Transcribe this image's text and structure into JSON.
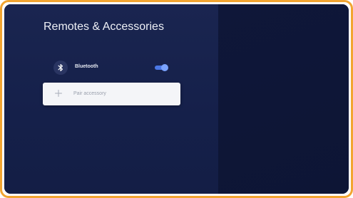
{
  "colors": {
    "frame_border": "#f2a531",
    "background": "#142046",
    "toggle_on": "#4b78e6",
    "card": "#f4f5f8"
  },
  "header": {
    "title": "Remotes & Accessories"
  },
  "bluetooth": {
    "icon": "bluetooth-icon",
    "label": "Bluetooth",
    "enabled": true
  },
  "pair": {
    "icon": "plus-icon",
    "label": "Pair accessory"
  }
}
